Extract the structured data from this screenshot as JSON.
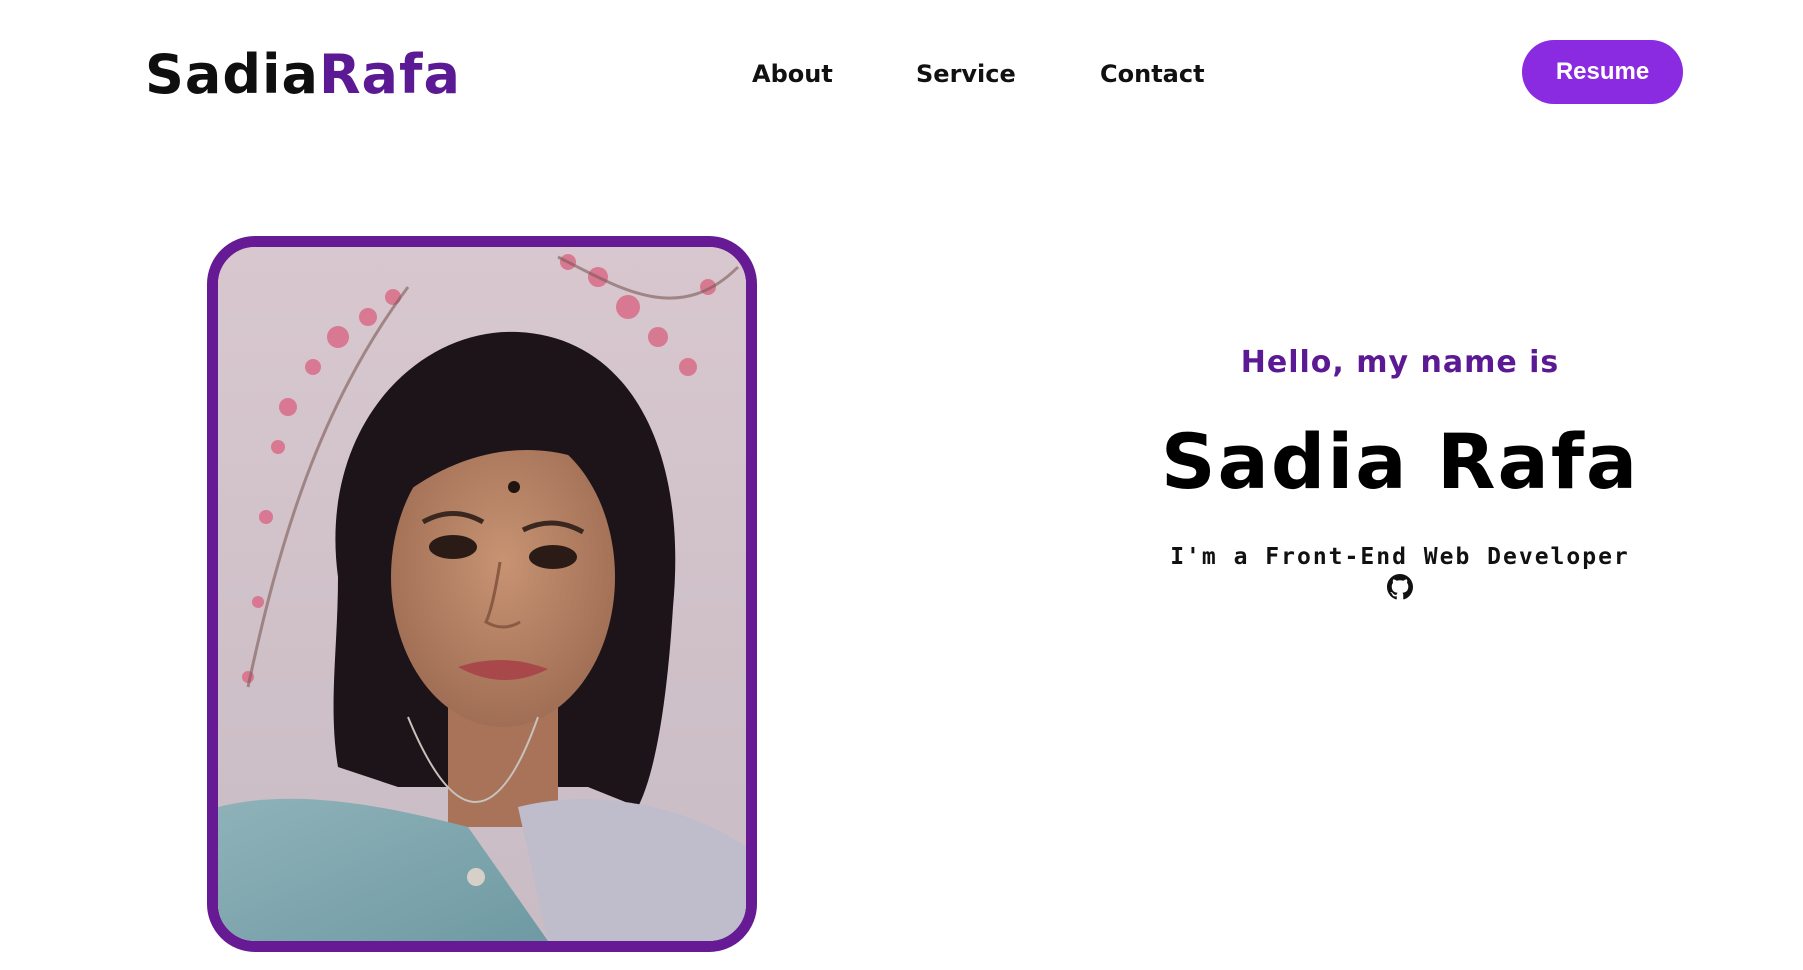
{
  "header": {
    "logo_first": "Sadia",
    "logo_second": "Rafa",
    "nav": {
      "about": "About",
      "service": "Service",
      "contact": "Contact"
    },
    "resume_label": "Resume"
  },
  "hero": {
    "greeting": "Hello, my name is",
    "name": "Sadia Rafa",
    "tagline": "I'm a Front-End Web Developer",
    "social_icon": "github-icon"
  },
  "colors": {
    "brand_purple": "#5b1a93",
    "button_purple": "#8a2be2",
    "frame_purple": "#661a94",
    "text": "#000000",
    "background": "#ffffff"
  }
}
